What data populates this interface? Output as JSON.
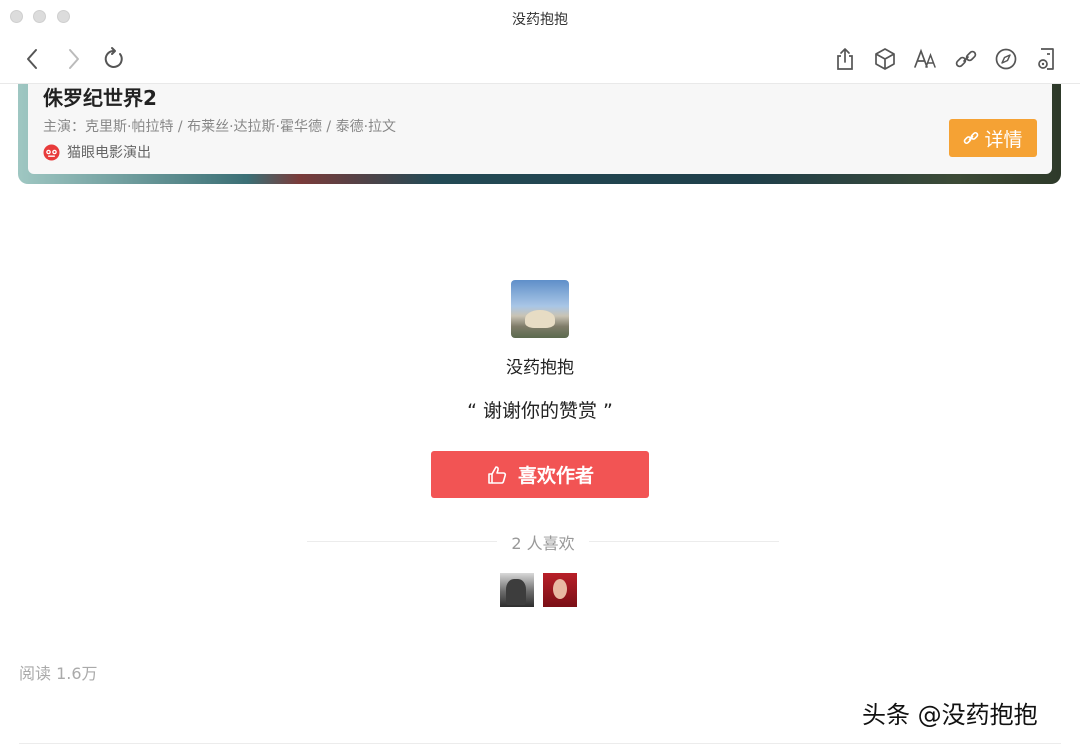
{
  "window": {
    "title": "没药抱抱"
  },
  "toolbar": {
    "icons": [
      "back-icon",
      "forward-icon",
      "reload-icon",
      "share-icon",
      "box-icon",
      "font-size-icon",
      "link-icon",
      "compass-icon",
      "speaker-icon"
    ]
  },
  "movie_card": {
    "title": "侏罗纪世界2",
    "cast": "主演：克里斯·帕拉特 / 布莱丝·达拉斯·霍华德 / 泰德·拉文",
    "source": "猫眼电影演出",
    "detail_label": "详情",
    "accent_color": "#f5a234"
  },
  "author": {
    "name": "没药抱抱",
    "thanks": "“ 谢谢你的赞赏 ”",
    "like_label": "喜欢作者",
    "like_color": "#f25454",
    "likes_count_text": "2 人喜欢"
  },
  "footer": {
    "reads": "阅读 1.6万",
    "watermark": "头条 @没药抱抱"
  }
}
